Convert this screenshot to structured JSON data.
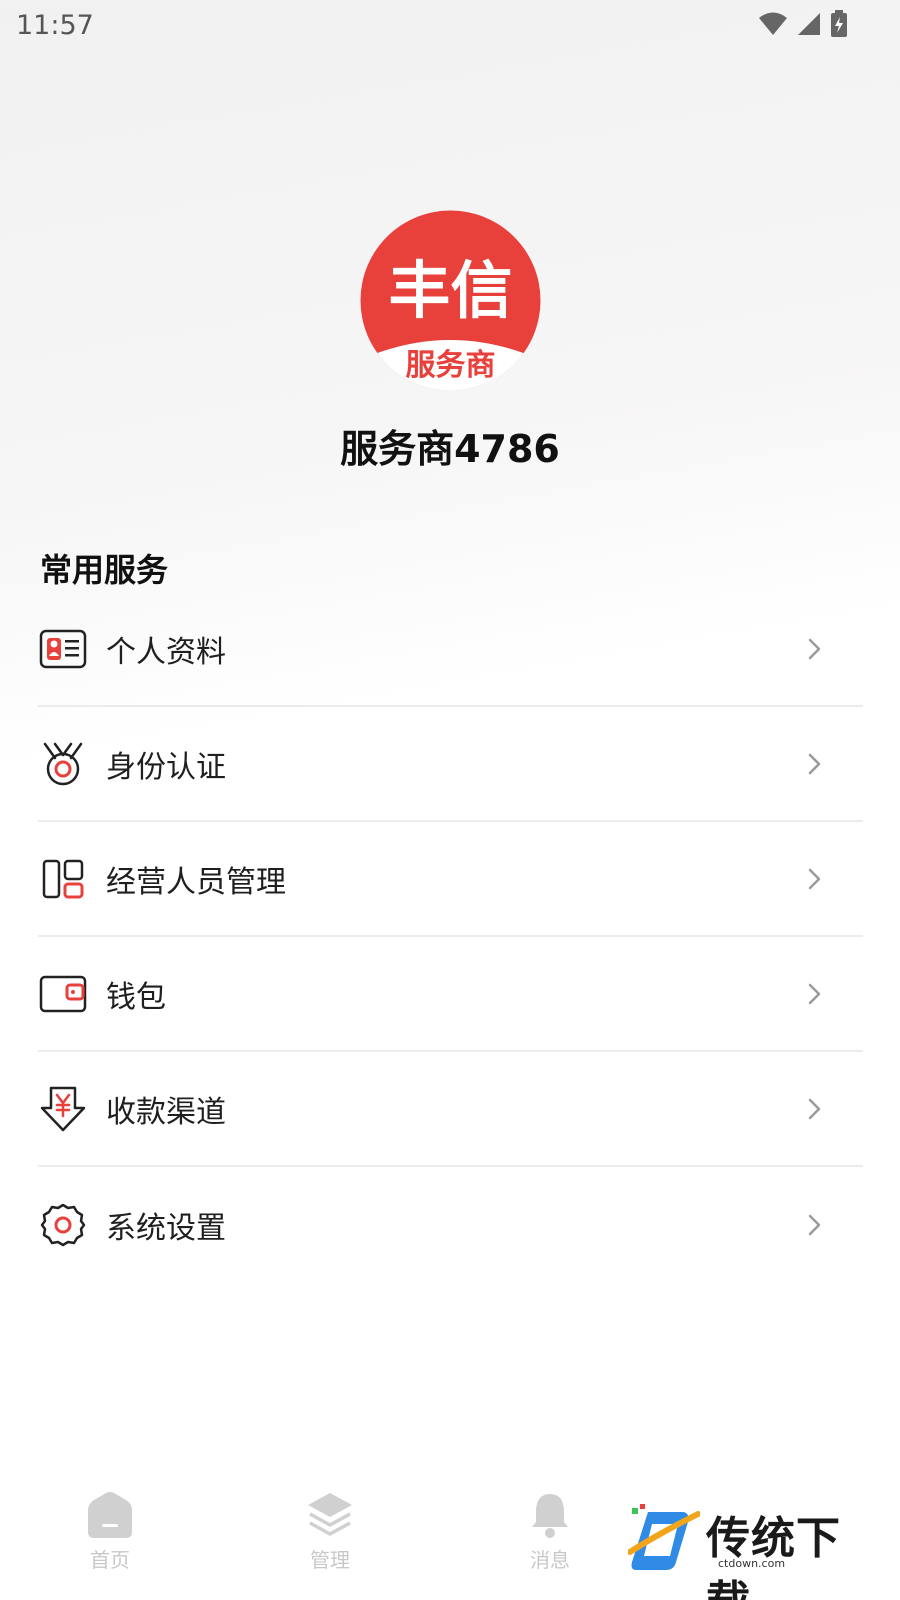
{
  "status_bar": {
    "time": "11:57"
  },
  "profile": {
    "logo_text_top": "丰信",
    "logo_text_bottom": "服务商",
    "username": "服务商4786"
  },
  "section": {
    "title": "常用服务"
  },
  "menu": [
    {
      "label": "个人资料",
      "icon": "profile-card-icon"
    },
    {
      "label": "身份认证",
      "icon": "medal-icon"
    },
    {
      "label": "经营人员管理",
      "icon": "staff-manage-icon"
    },
    {
      "label": "钱包",
      "icon": "wallet-icon"
    },
    {
      "label": "收款渠道",
      "icon": "payment-channel-icon"
    },
    {
      "label": "系统设置",
      "icon": "settings-gear-icon"
    }
  ],
  "tabbar": {
    "home": "首页",
    "manage": "管理",
    "messages": "消息"
  },
  "watermark": {
    "title": "传统下载",
    "url": "ctdown.com"
  },
  "colors": {
    "accent": "#e8413c",
    "text": "#1f1f1f",
    "muted": "#c8c8c8"
  }
}
